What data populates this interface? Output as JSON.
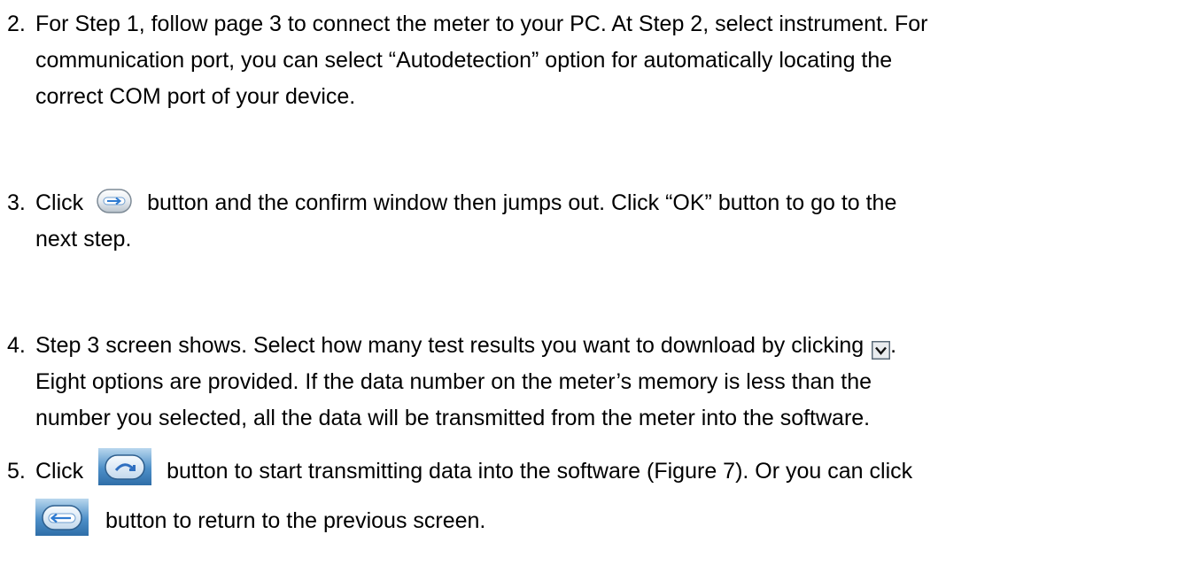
{
  "items": [
    {
      "number": "2.",
      "lines": [
        "For Step 1, follow page 3 to connect the meter to your PC. At Step 2, select instrument. For",
        "communication port, you can select “Autodetection” option for automatically locating the",
        "correct COM port of your device."
      ]
    },
    {
      "number": "3.",
      "line1_before": "Click",
      "line1_after": "button and the confirm window then jumps out. Click “OK” button to go to the",
      "line2": "next step.",
      "icon": "next-arrow-button-icon"
    },
    {
      "number": "4.",
      "line1_before": "Step 3 screen shows. Select how many test results you want to download by clicking",
      "line1_after": ".",
      "line2": "Eight options are provided. If the data number on the meter’s memory is less than the",
      "line3": "number you selected, all the data will be transmitted from the meter into the software.",
      "icon": "dropdown-arrow-icon"
    },
    {
      "number": "5.",
      "line1_before": "Click",
      "line1_after": "button to start transmitting data into the software (Figure 7). Or you can click",
      "line2_after": "button to return to the previous screen.",
      "icon_start": "start-transmit-button-icon",
      "icon_back": "back-arrow-button-icon"
    }
  ]
}
